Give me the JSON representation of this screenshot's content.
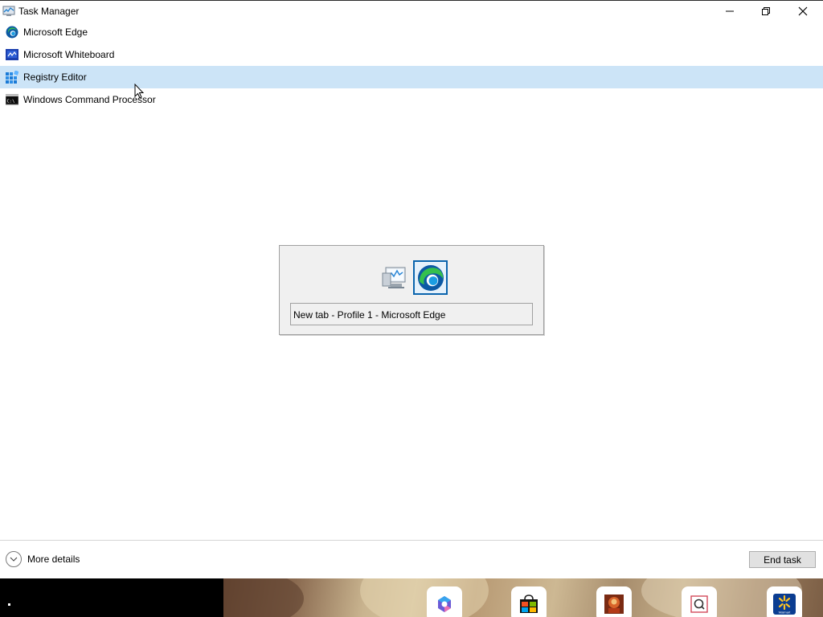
{
  "window": {
    "title": "Task Manager",
    "controls": [
      "minimize",
      "restore",
      "close"
    ]
  },
  "apps": [
    {
      "label": "Microsoft Edge",
      "icon": "edge-icon",
      "selected": false
    },
    {
      "label": "Microsoft Whiteboard",
      "icon": "whiteboard-icon",
      "selected": false
    },
    {
      "label": "Registry Editor",
      "icon": "registry-editor-icon",
      "selected": true
    },
    {
      "label": "Windows Command Processor",
      "icon": "cmd-icon",
      "selected": false
    }
  ],
  "footer": {
    "more_details": "More details",
    "end_task": "End task"
  },
  "switcher": {
    "caption": "New tab - Profile 1 - Microsoft Edge",
    "icons": [
      "task-manager-icon",
      "edge-icon"
    ],
    "selected_index": 1
  },
  "taskbar": {
    "apps": [
      "copilot-icon",
      "store-icon",
      "game-icon",
      "search-app-icon",
      "walmart-icon"
    ]
  },
  "colors": {
    "selection": "#cce4f7",
    "switcher_focus": "#0a64ad",
    "edge_blue": "#0c59a4",
    "edge_green": "#35c04e"
  }
}
